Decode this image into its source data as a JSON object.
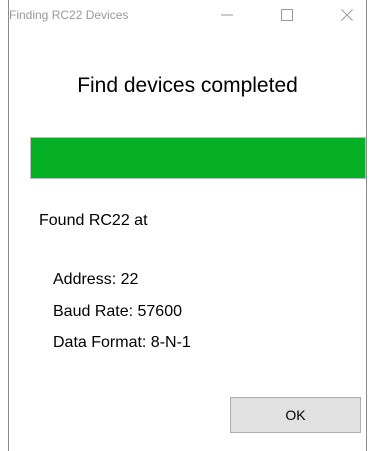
{
  "window": {
    "title": "Finding RC22 Devices",
    "controls": [
      "minimize-icon",
      "maximize-icon",
      "close-icon"
    ]
  },
  "heading": "Find devices completed",
  "progress": {
    "fraction": 1.0,
    "color": "#06b025"
  },
  "result": {
    "found_text": "Found RC22 at",
    "address_line": "Address:  22",
    "baud_rate_line": "Baud Rate: 57600",
    "data_format_line": "Data Format: 8-N-1"
  },
  "buttons": {
    "ok_label": "OK"
  }
}
